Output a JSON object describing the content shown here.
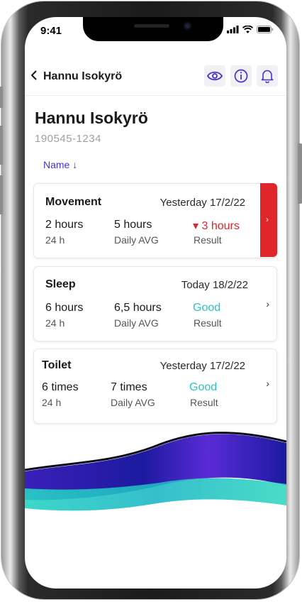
{
  "status_bar": {
    "time": "9:41"
  },
  "header": {
    "back_icon": "chevron-left-icon",
    "title": "Hannu Isokyrö"
  },
  "patient": {
    "name": "Hannu Isokyrö",
    "id": "190545-1234"
  },
  "sort": {
    "label": "Name ↓"
  },
  "cards": [
    {
      "title": "Movement",
      "date": "Yesterday 17/2/22",
      "value1": "2 hours",
      "sub1": "24 h",
      "value2": "5 hours",
      "sub2": "Daily AVG",
      "result": "▾ 3 hours",
      "result_label": "Result",
      "result_color": "#e0252b",
      "alert": true
    },
    {
      "title": "Sleep",
      "date": "Today 18/2/22",
      "value1": "6 hours",
      "sub1": "24 h",
      "value2": "6,5 hours",
      "sub2": "Daily AVG",
      "result": "Good",
      "result_label": "Result",
      "result_color": "#2ec4c4",
      "alert": false
    },
    {
      "title": "Toilet",
      "date": "Yesterday 17/2/22",
      "value1": "6 times",
      "sub1": "24 h",
      "value2": "7 times",
      "sub2": "Daily AVG",
      "result": "Good",
      "result_label": "Result",
      "result_color": "#2ec4c4",
      "alert": false
    }
  ],
  "colors": {
    "accent": "#4b2fd6",
    "alert": "#e0252b",
    "good": "#2ec4c4"
  }
}
